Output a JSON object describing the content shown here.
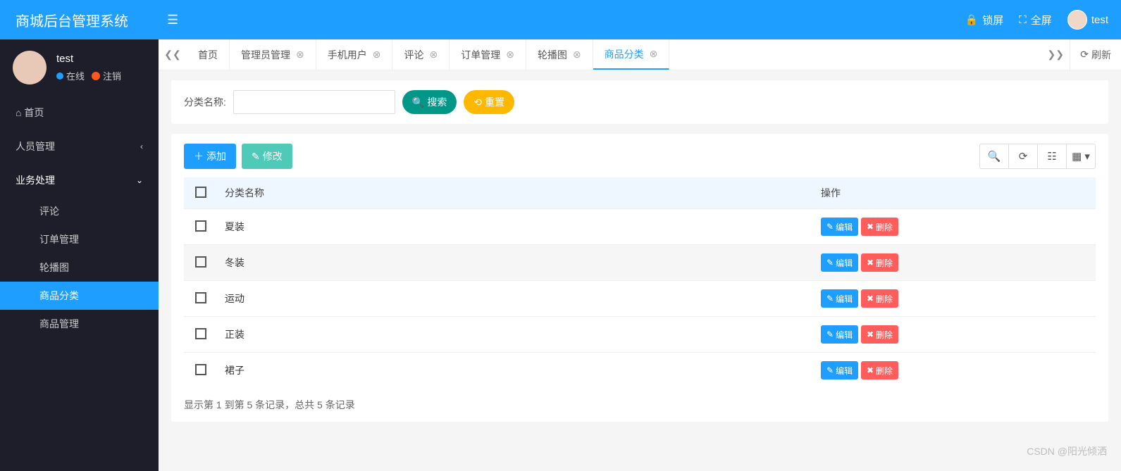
{
  "brand": "商城后台管理系统",
  "header": {
    "lock": "锁屏",
    "fullscreen": "全屏",
    "username": "test"
  },
  "user": {
    "name": "test",
    "online": "在线",
    "logout": "注销"
  },
  "menu": {
    "home": "首页",
    "people": "人员管理",
    "business": "业务处理",
    "comment": "评论",
    "order": "订单管理",
    "carousel": "轮播图",
    "category": "商品分类",
    "product": "商品管理"
  },
  "tabs": [
    {
      "label": "首页",
      "closable": false,
      "active": false
    },
    {
      "label": "管理员管理",
      "closable": true,
      "active": false
    },
    {
      "label": "手机用户",
      "closable": true,
      "active": false
    },
    {
      "label": "评论",
      "closable": true,
      "active": false
    },
    {
      "label": "订单管理",
      "closable": true,
      "active": false
    },
    {
      "label": "轮播图",
      "closable": true,
      "active": false
    },
    {
      "label": "商品分类",
      "closable": true,
      "active": true
    }
  ],
  "refresh": "刷新",
  "search": {
    "label": "分类名称:",
    "search_btn": "搜索",
    "reset_btn": "重置"
  },
  "toolbar": {
    "add": "添加",
    "modify": "修改"
  },
  "table": {
    "col_name": "分类名称",
    "col_op": "操作",
    "edit": "编辑",
    "delete": "删除",
    "rows": [
      {
        "name": "夏装"
      },
      {
        "name": "冬装"
      },
      {
        "name": "运动"
      },
      {
        "name": "正装"
      },
      {
        "name": "裙子"
      }
    ]
  },
  "pager": "显示第 1 到第 5 条记录，总共 5 条记录",
  "watermark": "CSDN @阳光倾洒"
}
